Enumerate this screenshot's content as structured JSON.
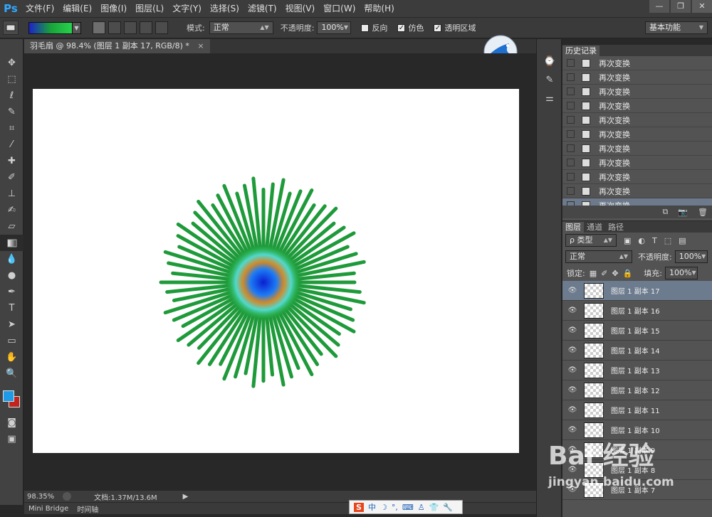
{
  "app": {
    "logo": "Ps",
    "menu": [
      "文件(F)",
      "编辑(E)",
      "图像(I)",
      "图层(L)",
      "文字(Y)",
      "选择(S)",
      "滤镜(T)",
      "视图(V)",
      "窗口(W)",
      "帮助(H)"
    ],
    "window_controls": [
      "—",
      "❐",
      "✕"
    ]
  },
  "options": {
    "mode_label": "模式:",
    "mode_value": "正常",
    "opacity_label": "不透明度:",
    "opacity_value": "100%",
    "reverse_label": "反向",
    "dither_label": "仿色",
    "transparency_label": "透明区域",
    "workspace": "基本功能",
    "gradient_colors": [
      "#1d22c9",
      "#19a23a",
      "#28d24c"
    ]
  },
  "document": {
    "tab_title": "羽毛扇 @ 98.4% (图层 1 副本 17, RGB/8) *",
    "zoom": "98.35%",
    "doc_info": "文档:1.37M/13.6M",
    "bottom_tabs": [
      "Mini Bridge",
      "时间轴"
    ]
  },
  "history": {
    "tab": "历史记录",
    "items": [
      "再次变换",
      "再次变换",
      "再次变换",
      "再次变换",
      "再次变换",
      "再次变换",
      "再次变换",
      "再次变换",
      "再次变换",
      "再次变换",
      "再次变换"
    ],
    "selected_index": 10
  },
  "layers": {
    "tabs": [
      "图层",
      "通道",
      "路径"
    ],
    "filter_label": "ρ 类型",
    "blend_mode": "正常",
    "opacity_label": "不透明度:",
    "opacity_value": "100%",
    "lock_label": "锁定:",
    "fill_label": "填充:",
    "fill_value": "100%",
    "items": [
      "图层 1 副本 17",
      "图层 1 副本 16",
      "图层 1 副本 15",
      "图层 1 副本 14",
      "图层 1 副本 13",
      "图层 1 副本 12",
      "图层 1 副本 11",
      "图层 1 副本 10",
      "图层 1 副本 9",
      "图层 1 副本 8",
      "图层 1 副本 7"
    ],
    "selected_index": 0
  },
  "taskbar": {
    "items": [
      "S",
      "中",
      "☽",
      "°,",
      "⌨",
      "♙",
      "👕",
      "🔧"
    ]
  },
  "watermark": {
    "brand": "Bai 经验",
    "url": "jingyan.baidu.com"
  },
  "colors": {
    "foreground": "#1e9be8",
    "background": "#c0241c",
    "accent": "#6c7b8e"
  }
}
